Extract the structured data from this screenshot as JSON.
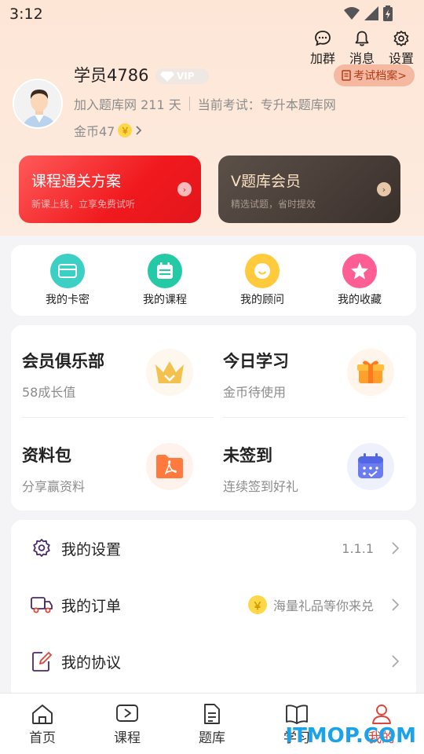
{
  "status_bar": {
    "time": "3:12"
  },
  "top_actions": [
    {
      "label": "加群",
      "icon": "chat-bubble-icon"
    },
    {
      "label": "消息",
      "icon": "bell-icon"
    },
    {
      "label": "设置",
      "icon": "gear-icon"
    }
  ],
  "profile": {
    "username": "学员4786",
    "vip_label": "VIP",
    "exam_archive": "考试档案>",
    "join_text": "加入题库网 211 天",
    "current_exam": "当前考试：专升本题库网",
    "coins_text": "金币47",
    "coin_symbol": "￥"
  },
  "promos": [
    {
      "title": "课程通关方案",
      "subtitle": "新课上线，立享免费试听"
    },
    {
      "title": "V题库会员",
      "subtitle": "精选试题，省时提效"
    }
  ],
  "quick_actions": [
    {
      "label": "我的卡密",
      "icon": "card-icon",
      "color": "#3cc9c0"
    },
    {
      "label": "我的课程",
      "icon": "calendar-icon",
      "color": "#26c9a8"
    },
    {
      "label": "我的顾问",
      "icon": "chat-smile-icon",
      "color": "#ffc93b"
    },
    {
      "label": "我的收藏",
      "icon": "star-icon",
      "color": "#ff5c93"
    }
  ],
  "features": [
    {
      "title": "会员俱乐部",
      "subtitle": "58成长值",
      "icon": "crown-icon"
    },
    {
      "title": "今日学习",
      "subtitle": "金币待使用",
      "icon": "gift-box-icon"
    },
    {
      "title": "资料包",
      "subtitle": "分享赢资料",
      "icon": "pdf-folder-icon"
    },
    {
      "title": "未签到",
      "subtitle": "连续签到好礼",
      "icon": "calendar-check-icon"
    }
  ],
  "menu": [
    {
      "label": "我的设置",
      "right_text": "1.1.1",
      "icon": "gear-icon"
    },
    {
      "label": "我的订单",
      "right_text": "海量礼品等你来兑",
      "icon": "truck-icon"
    },
    {
      "label": "我的协议",
      "right_text": "",
      "icon": "edit-doc-icon"
    }
  ],
  "tabbar": [
    {
      "label": "首页",
      "icon": "home-icon"
    },
    {
      "label": "课程",
      "icon": "play-icon"
    },
    {
      "label": "题库",
      "icon": "doc-icon"
    },
    {
      "label": "学习",
      "icon": "book-icon"
    },
    {
      "label": "我的",
      "icon": "user-icon",
      "active": true
    }
  ],
  "watermark": "ITMOP.COM"
}
